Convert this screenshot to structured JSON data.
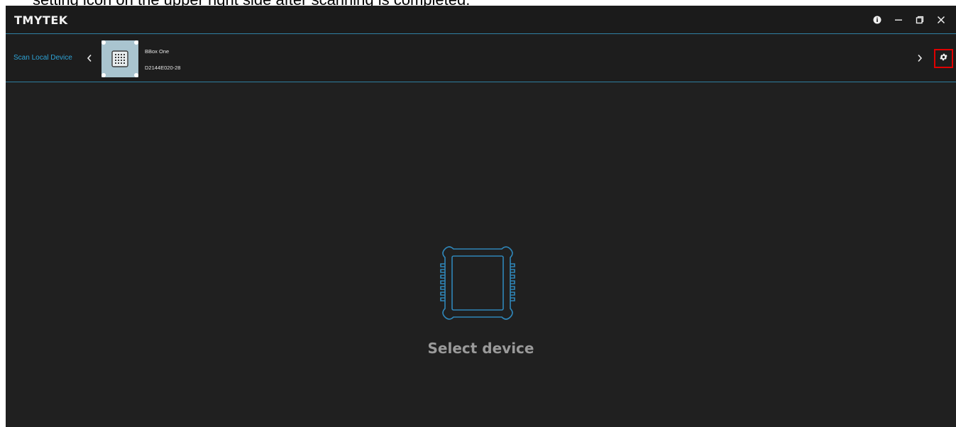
{
  "caption": "setting icon on the upper right side after scanning is completed.",
  "titlebar": {
    "brand": "TMYTEK",
    "controls": {
      "info_icon": "info-icon",
      "minimize_icon": "minimize-icon",
      "restore_icon": "restore-icon",
      "close_icon": "close-icon"
    }
  },
  "devicebar": {
    "scan_label": "Scan Local Device",
    "device": {
      "name": "BBox One",
      "serial": "D2144E020-28"
    }
  },
  "main": {
    "empty_state_label": "Select device"
  },
  "colors": {
    "background": "#202020",
    "accent": "#2ea3d6",
    "divider": "#2e7ea1",
    "highlight_box": "#e00000",
    "device_thumb": "#a9c4cf"
  }
}
